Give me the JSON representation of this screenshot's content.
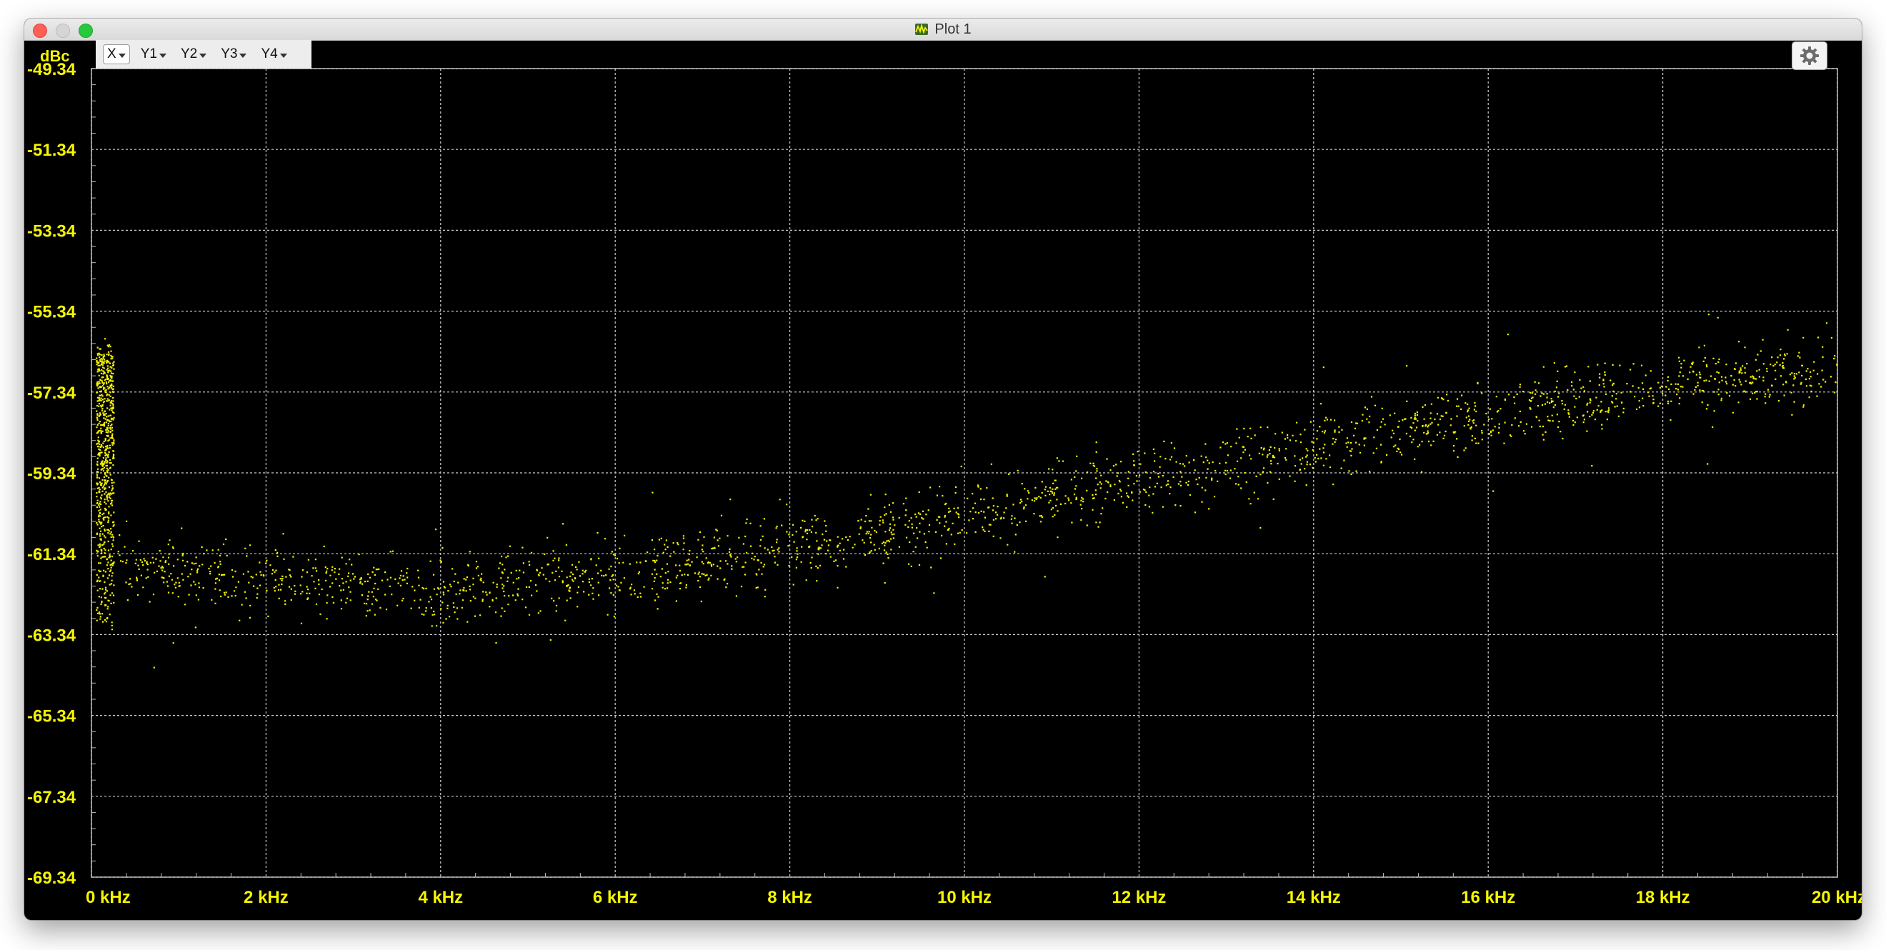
{
  "window": {
    "title": "Plot 1",
    "app_icon": "waveform-icon"
  },
  "toolbar": {
    "y_unit_label": "dBc",
    "axis_buttons": [
      {
        "label": "X",
        "selected": true
      },
      {
        "label": "Y1",
        "selected": false
      },
      {
        "label": "Y2",
        "selected": false
      },
      {
        "label": "Y3",
        "selected": false
      },
      {
        "label": "Y4",
        "selected": false
      }
    ],
    "settings_icon": "gear-icon"
  },
  "colors": {
    "background": "#000000",
    "trace": "#f5f500",
    "tick_labels": "#f5f500",
    "grid": "#cfcfcf"
  },
  "chart_data": {
    "type": "scatter",
    "title": "",
    "xlabel": "",
    "ylabel": "dBc",
    "xlim": [
      0,
      20
    ],
    "ylim": [
      -69.34,
      -49.34
    ],
    "grid": true,
    "x_ticks": [
      0,
      2,
      4,
      6,
      8,
      10,
      12,
      14,
      16,
      18,
      20
    ],
    "x_tick_labels": [
      "0 kHz",
      "2 kHz",
      "4 kHz",
      "6 kHz",
      "8 kHz",
      "10 kHz",
      "12 kHz",
      "14 kHz",
      "16 kHz",
      "18 kHz",
      "20 kHz"
    ],
    "y_ticks": [
      -49.34,
      -51.34,
      -53.34,
      -55.34,
      -57.34,
      -59.34,
      -61.34,
      -63.34,
      -65.34,
      -67.34,
      -69.34
    ],
    "y_tick_labels": [
      "-49.34",
      "-51.34",
      "-53.34",
      "-55.34",
      "-57.34",
      "-59.34",
      "-61.34",
      "-63.34",
      "-65.34",
      "-67.34",
      "-69.34"
    ],
    "x_unit": "kHz",
    "series": [
      {
        "color": "#f5f500",
        "trend": {
          "x": [
            0.3,
            1,
            2,
            3,
            4,
            5,
            6,
            7,
            8,
            9,
            10,
            11,
            12,
            13,
            14,
            15,
            16,
            17,
            18,
            19,
            20
          ],
          "y": [
            -61.6,
            -61.7,
            -62.0,
            -62.1,
            -62.2,
            -62.0,
            -61.9,
            -61.6,
            -61.2,
            -60.8,
            -60.4,
            -59.9,
            -59.5,
            -59.1,
            -58.7,
            -58.2,
            -57.9,
            -57.5,
            -57.2,
            -56.9,
            -56.7
          ]
        },
        "spread_db": 0.7,
        "low_frequency_spike": {
          "x": [
            0.05,
            0.25
          ],
          "y": [
            -63.2,
            -56.3
          ]
        }
      }
    ]
  }
}
